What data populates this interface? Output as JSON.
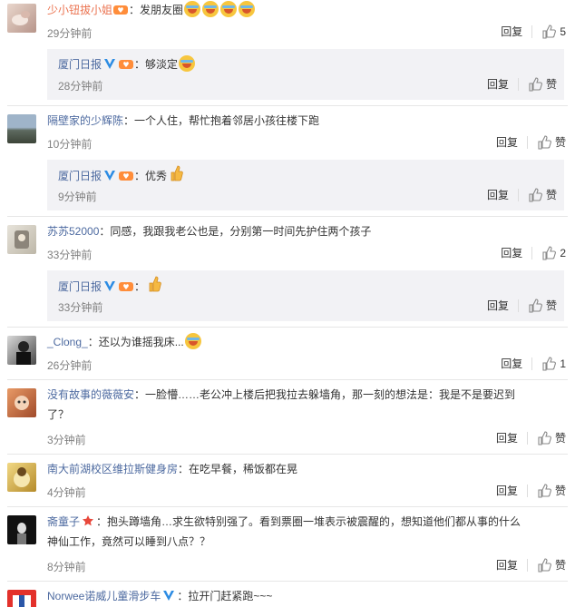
{
  "actions": {
    "reply": "回复",
    "like": "赞"
  },
  "comments": [
    {
      "name": "少小钮拔小姐",
      "text": "：发朋友圈",
      "time": "29分钟前",
      "likes": "5",
      "reply": {
        "name": "厦门日报",
        "text": "：够淡定",
        "time": "28分钟前",
        "likes": "赞"
      }
    },
    {
      "name": "隔壁家的少辉陈",
      "text": "：一个人住，帮忙抱着邻居小孩往楼下跑",
      "time": "10分钟前",
      "likes": "赞",
      "reply": {
        "name": "厦门日报",
        "text": "：优秀",
        "time": "9分钟前",
        "likes": "赞"
      }
    },
    {
      "name": "苏苏52000",
      "text": "：同感，我跟我老公也是，分别第一时间先护住两个孩子",
      "time": "33分钟前",
      "likes": "2",
      "reply": {
        "name": "厦门日报",
        "text": "：",
        "time": "33分钟前",
        "likes": "赞"
      }
    },
    {
      "name": "_Clong_",
      "text": "：还以为谁摇我床...",
      "time": "26分钟前",
      "likes": "1"
    },
    {
      "name": "没有故事的薇薇安",
      "text": "：一脸懵……老公冲上楼后把我拉去躲墙角，那一刻的想法是：我是不是要迟到",
      "text2": "了？",
      "time": "3分钟前",
      "likes": "赞"
    },
    {
      "name": "南大前湖校区维拉斯健身房",
      "text": "：在吃早餐，稀饭都在晃",
      "time": "4分钟前",
      "likes": "赞"
    },
    {
      "name": "斋童子",
      "text": "：抱头蹲墙角…求生欲特别强了。看到票圈一堆表示被震醒的，想知道他们都从事的什么",
      "text2": "神仙工作，竟然可以睡到八点？？",
      "time": "8分钟前",
      "likes": "赞"
    },
    {
      "name": "Norwee诺威儿童滑步车",
      "text": "：拉开门赶紧跑~~~"
    }
  ]
}
